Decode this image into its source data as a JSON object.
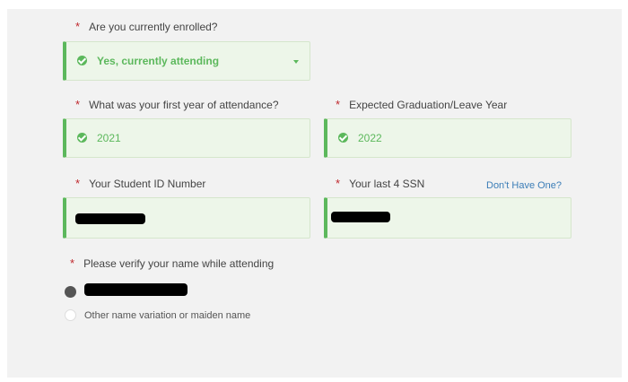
{
  "form": {
    "enrolled": {
      "required_mark": "*",
      "label": "Are you currently enrolled?",
      "value": "Yes, currently attending"
    },
    "first_year": {
      "required_mark": "*",
      "label": "What was your first year of attendance?",
      "value": "2021"
    },
    "grad_year": {
      "required_mark": "*",
      "label": "Expected Graduation/Leave Year",
      "value": "2022"
    },
    "student_id": {
      "required_mark": "*",
      "label": "Your Student ID Number"
    },
    "ssn": {
      "required_mark": "*",
      "label": "Your last 4 SSN",
      "link": "Don't Have One?"
    },
    "verify_name": {
      "required_mark": "*",
      "label": "Please verify your name while attending",
      "options": [
        {
          "selected": true
        },
        {
          "label": "Other name variation or maiden name",
          "selected": false
        }
      ]
    }
  },
  "colors": {
    "success": "#5cb85c",
    "field_bg": "#edf6e9",
    "required": "#c0272d",
    "link": "#3b7db7",
    "panel_bg": "#f2f2f2"
  },
  "icons": {
    "status": "check-circle-icon",
    "dropdown": "caret-down-icon"
  }
}
